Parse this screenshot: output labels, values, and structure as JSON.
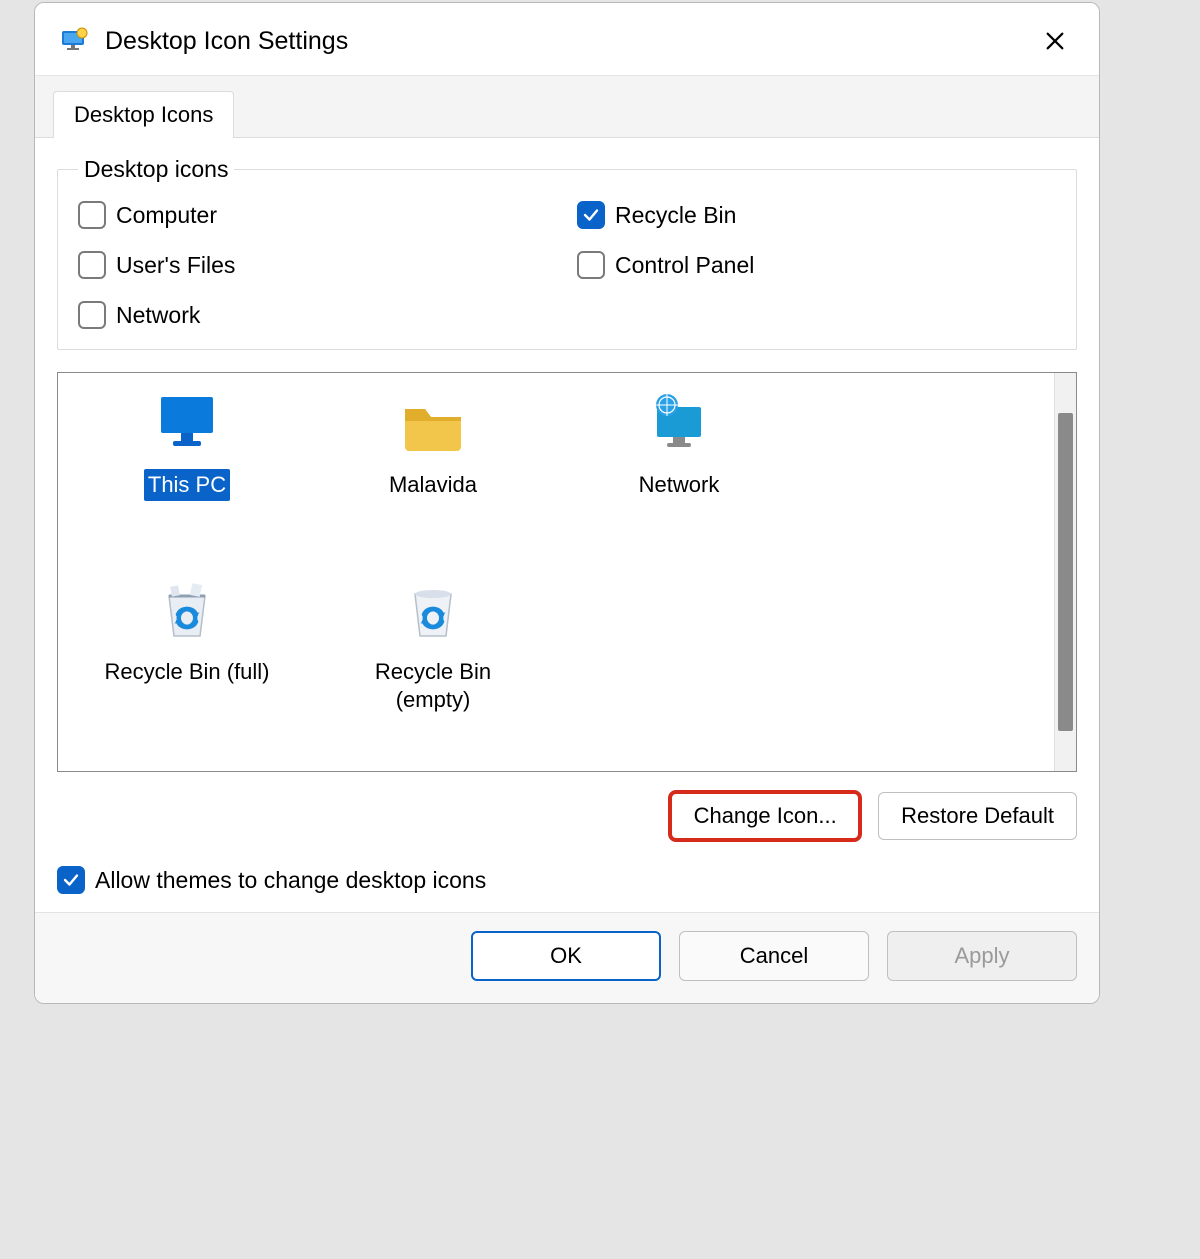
{
  "title": "Desktop Icon Settings",
  "tab": {
    "label": "Desktop Icons"
  },
  "groupbox": {
    "legend": "Desktop icons",
    "items": [
      {
        "label": "Computer",
        "checked": false
      },
      {
        "label": "Recycle Bin",
        "checked": true
      },
      {
        "label": "User's Files",
        "checked": false
      },
      {
        "label": "Control Panel",
        "checked": false
      },
      {
        "label": "Network",
        "checked": false
      }
    ]
  },
  "icons": [
    {
      "label": "This PC",
      "selected": true
    },
    {
      "label": "Malavida",
      "selected": false
    },
    {
      "label": "Network",
      "selected": false
    },
    {
      "label": "Recycle Bin (full)",
      "selected": false
    },
    {
      "label": "Recycle Bin (empty)",
      "selected": false
    }
  ],
  "buttons": {
    "change_icon": "Change Icon...",
    "restore_default": "Restore Default",
    "ok": "OK",
    "cancel": "Cancel",
    "apply": "Apply"
  },
  "allow_themes": {
    "label": "Allow themes to change desktop icons",
    "checked": true
  }
}
